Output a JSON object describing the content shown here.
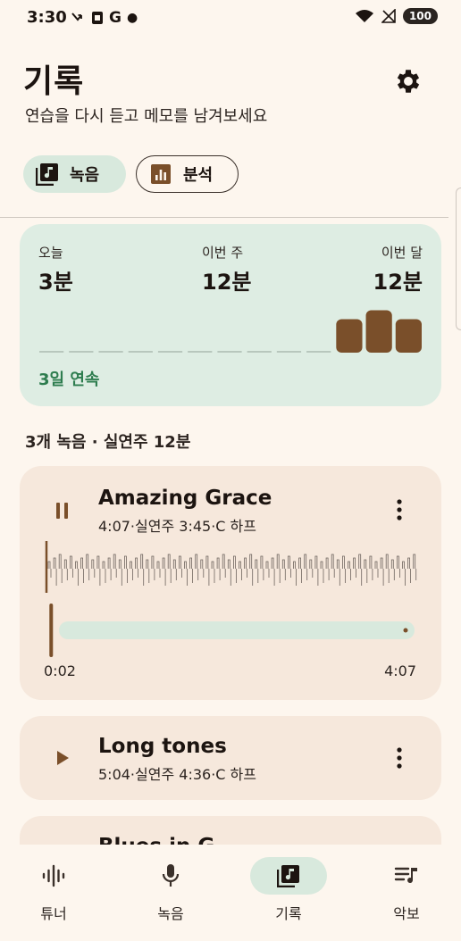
{
  "status": {
    "time": "3:30",
    "left_icons": [
      "missed-call",
      "photo",
      "G",
      "•"
    ],
    "battery": "100"
  },
  "header": {
    "title": "기록",
    "subtitle": "연습을 다시 듣고 메모를 남겨보세요"
  },
  "tabs": [
    {
      "label": "녹음",
      "selected": true
    },
    {
      "label": "분석",
      "selected": false
    }
  ],
  "stats": {
    "today_label": "오늘",
    "today_value": "3분",
    "week_label": "이번 주",
    "week_value": "12분",
    "month_label": "이번 달",
    "month_value": "12분",
    "daily_levels": [
      0,
      0,
      0,
      0,
      0,
      0,
      0,
      0,
      0,
      0,
      0.75,
      0.95,
      0.75
    ],
    "streak": "3일 연속"
  },
  "summary": "3개 녹음 · 실연주 12분",
  "recordings": [
    {
      "title": "Amazing Grace",
      "meta": "4:07·실연주 3:45·C 하프",
      "state": "playing",
      "position": "0:02",
      "duration": "4:07",
      "progress": 0.008
    },
    {
      "title": "Long tones",
      "meta": "5:04·실연주 4:36·C 하프",
      "state": "paused"
    },
    {
      "title": "Blues in G",
      "meta": "",
      "state": "paused"
    }
  ],
  "nav": [
    {
      "label": "튜너",
      "icon": "waveform-icon",
      "active": false
    },
    {
      "label": "녹음",
      "icon": "mic-icon",
      "active": false
    },
    {
      "label": "기록",
      "icon": "library-music-icon",
      "active": true
    },
    {
      "label": "악보",
      "icon": "sheet-music-icon",
      "active": false
    }
  ],
  "colors": {
    "accent": "#7a4f2a",
    "mint": "#d8e9dd",
    "streak": "#2e7d4f",
    "card": "#f6e8dc",
    "background": "#fdf6ee"
  }
}
